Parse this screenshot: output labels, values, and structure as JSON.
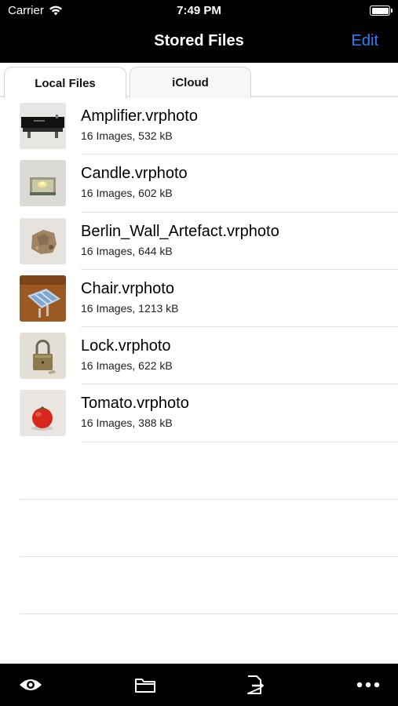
{
  "status": {
    "carrier": "Carrier",
    "time": "7:49 PM"
  },
  "nav": {
    "title": "Stored Files",
    "edit_label": "Edit"
  },
  "tabs": [
    {
      "label": "Local Files",
      "active": true
    },
    {
      "label": "iCloud",
      "active": false
    }
  ],
  "files": [
    {
      "name": "Amplifier.vrphoto",
      "meta": "16 Images, 532 kB",
      "thumb": "amplifier"
    },
    {
      "name": "Candle.vrphoto",
      "meta": "16 Images, 602 kB",
      "thumb": "candle"
    },
    {
      "name": "Berlin_Wall_Artefact.vrphoto",
      "meta": "16 Images, 644 kB",
      "thumb": "stone"
    },
    {
      "name": "Chair.vrphoto",
      "meta": "16 Images, 1213 kB",
      "thumb": "chair"
    },
    {
      "name": "Lock.vrphoto",
      "meta": "16 Images, 622 kB",
      "thumb": "padlock"
    },
    {
      "name": "Tomato.vrphoto",
      "meta": "16 Images, 388 kB",
      "thumb": "tomato"
    }
  ],
  "toolbar": {
    "items": [
      "eye-icon",
      "folder-icon",
      "export-icon",
      "more-icon"
    ]
  },
  "colors": {
    "accent": "#2d7ff9",
    "bar": "#000000"
  }
}
